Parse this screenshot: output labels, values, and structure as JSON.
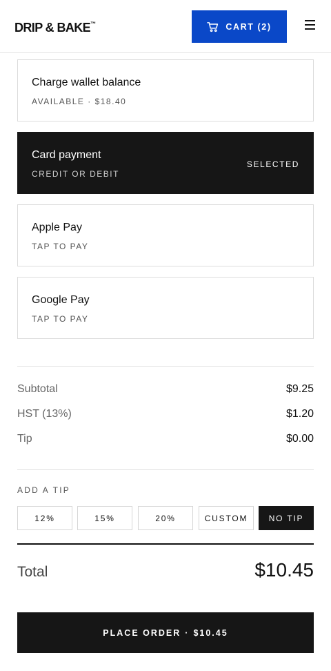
{
  "header": {
    "logo": "DRIP & BAKE",
    "logo_mark": "™",
    "cart_icon": "cart-icon",
    "cart_label": "CART (2)",
    "menu_icon": "hamburger-menu-icon"
  },
  "payment_options": [
    {
      "name": "Charge wallet balance",
      "sub": "AVAILABLE · $18.40",
      "selected": false
    },
    {
      "name": "Card payment",
      "sub": "CREDIT OR DEBIT",
      "selected": true,
      "state": "SELECTED"
    },
    {
      "name": "Apple Pay",
      "sub": "TAP TO PAY",
      "selected": false
    },
    {
      "name": "Google Pay",
      "sub": "TAP TO PAY",
      "selected": false
    }
  ],
  "summary": {
    "subtotal_label": "Subtotal",
    "subtotal_value": "$9.25",
    "tax_label": "HST (13%)",
    "tax_value": "$1.20",
    "tip_label": "Tip",
    "tip_value": "$0.00"
  },
  "tip": {
    "title": "ADD A TIP",
    "options": [
      "12%",
      "15%",
      "20%",
      "CUSTOM",
      "NO TIP"
    ],
    "selected": "NO TIP"
  },
  "total": {
    "label": "Total",
    "value": "$10.45"
  },
  "place_order": {
    "label": "PLACE ORDER",
    "separator": "·",
    "amount": "$10.45"
  },
  "colors": {
    "accent": "#0a48c8",
    "dark": "#161616",
    "border": "#dcdcdc"
  }
}
